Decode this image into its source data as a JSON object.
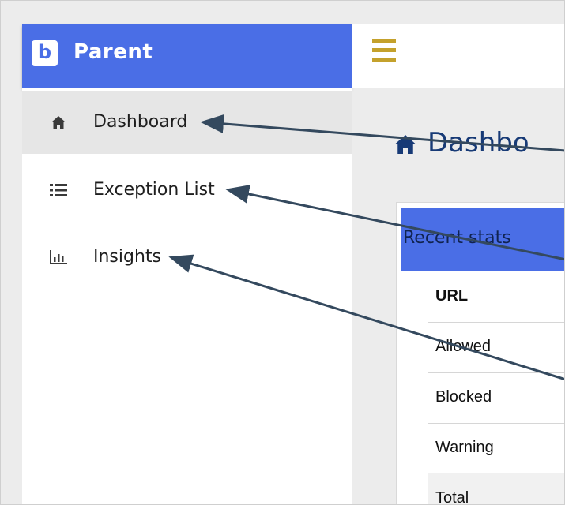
{
  "brand": {
    "logo_letter": "b",
    "title": "Parent"
  },
  "header": {
    "menu_icon": "hamburger-icon"
  },
  "sidebar": {
    "items": [
      {
        "label": "Dashboard",
        "icon": "home-icon",
        "active": true
      },
      {
        "label": "Exception List",
        "icon": "list-icon",
        "active": false
      },
      {
        "label": "Insights",
        "icon": "bar-chart-icon",
        "active": false
      }
    ]
  },
  "main": {
    "title": "Dashbo",
    "title_icon": "home-icon",
    "card": {
      "header": "Recent stats",
      "rows": [
        {
          "label": "URL"
        },
        {
          "label": "Allowed"
        },
        {
          "label": "Blocked"
        },
        {
          "label": "Warning"
        },
        {
          "label": "Total"
        }
      ]
    }
  },
  "colors": {
    "brand": "#4a6ee6",
    "hamburger": "#c4a12c",
    "title": "#173a76",
    "annotation_arrow": "#34495e"
  }
}
